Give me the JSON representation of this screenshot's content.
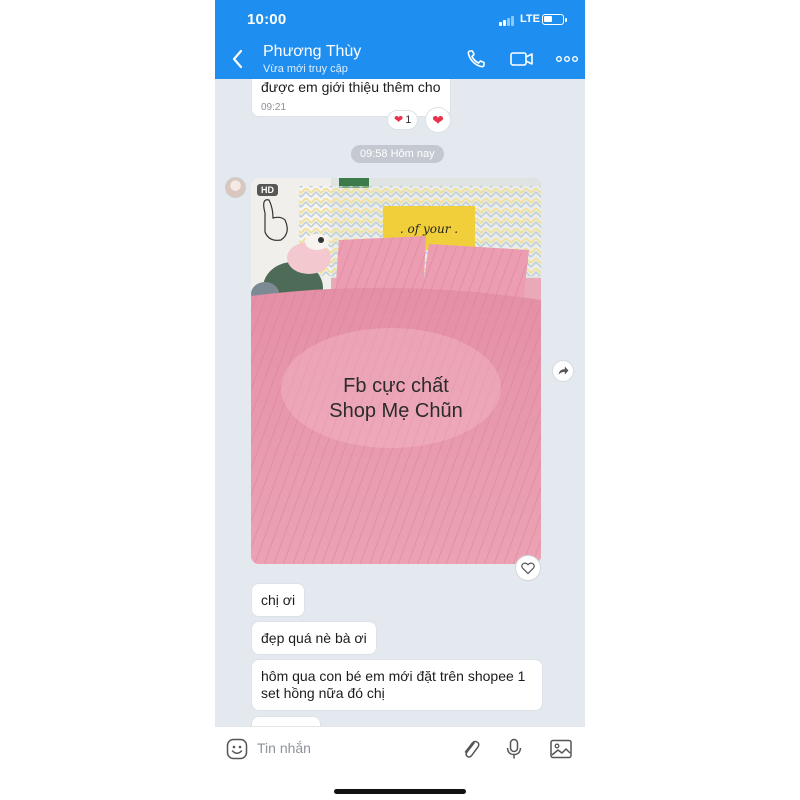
{
  "status_bar": {
    "time": "10:00",
    "network": "LTE",
    "battery_level": 0.45
  },
  "header": {
    "contact_name": "Phương Thùy",
    "contact_status": "Vừa mới truy cập",
    "icons": [
      "back-icon",
      "phone-icon",
      "video-call-icon",
      "more-icon"
    ]
  },
  "messages": {
    "top_fragment": {
      "text": "được em giới thiệu thêm cho",
      "time": "09:21",
      "reaction_count": "1"
    },
    "time_divider": "09:58 Hôm nay",
    "photo": {
      "badge": "HD",
      "overlay_line1": "Fb cực chất",
      "overlay_line2": "Shop Mẹ Chũn",
      "pillow_print": ". of your ."
    },
    "texts": [
      "chị ơi",
      "đẹp quá nè bà ơi",
      "hôm qua con bé em mới đặt trên shopee 1 set hồng nữa đó chị"
    ]
  },
  "composer": {
    "placeholder": "Tin nhắn",
    "icons": [
      "emoji-icon",
      "attachment-icon",
      "microphone-icon",
      "image-icon"
    ]
  },
  "colors": {
    "header_blue": "#1f8ef1",
    "chat_bg": "#e4e9f0",
    "reaction_red": "#e8334a"
  }
}
